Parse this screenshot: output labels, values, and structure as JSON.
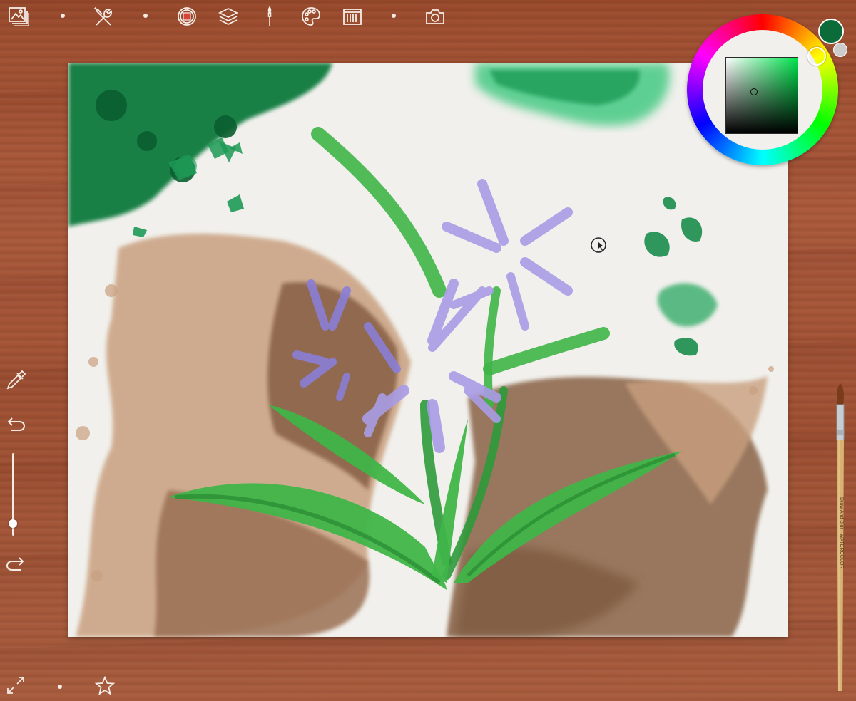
{
  "app": {
    "name": "Watercolor painting app"
  },
  "toolbar": {
    "items": [
      {
        "id": "gallery",
        "icon": "gallery-icon"
      },
      {
        "id": "tools",
        "icon": "tools-icon"
      },
      {
        "id": "brush-shape",
        "icon": "brush-shape-icon"
      },
      {
        "id": "layers",
        "icon": "layers-icon"
      },
      {
        "id": "brushes",
        "icon": "paintbrush-icon"
      },
      {
        "id": "palette",
        "icon": "palette-icon"
      },
      {
        "id": "textures",
        "icon": "canvas-texture-icon"
      },
      {
        "id": "camera",
        "icon": "camera-icon"
      }
    ]
  },
  "left_tools": {
    "eyedropper": "eyedropper-icon",
    "undo": "undo-icon",
    "redo": "redo-icon",
    "brush_size": 0.85
  },
  "bottom_tools": {
    "fullscreen": "expand-icon",
    "favorites": "star-icon"
  },
  "color_picker": {
    "current_color": "#0b6b39",
    "hue_color": "#00e34d",
    "previous_color": "#cccccc"
  },
  "brush": {
    "imprint": "Draw And Blur - WATERCOLOR"
  },
  "colors": {
    "wood": "#a0522d",
    "paper": "#f1f0ec",
    "leaf_green": "#38b43c",
    "dark_green": "#0a7a3c",
    "petal_lavender": "#a99ce6",
    "earth_brown": "#9a7052"
  }
}
